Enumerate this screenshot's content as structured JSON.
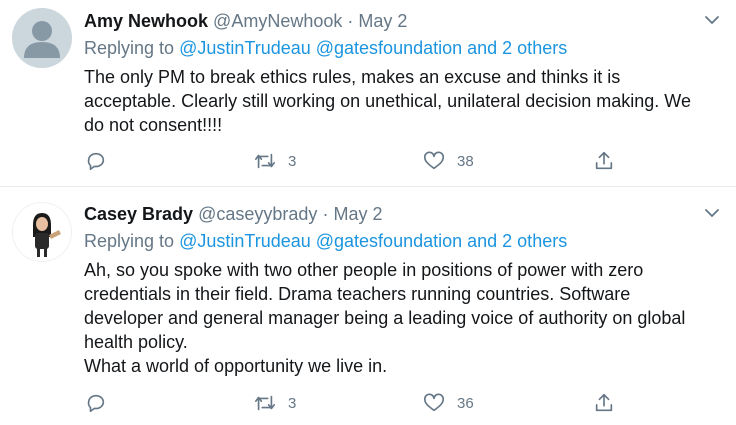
{
  "tweets": [
    {
      "display_name": "Amy Newhook",
      "handle": "@AmyNewhook",
      "separator": "·",
      "date": "May 2",
      "replying_prefix": "Replying to",
      "replying_mentions": "@JustinTrudeau @gatesfoundation and 2 others",
      "text_lines": [
        "The only PM to break ethics rules, makes an excuse and thinks it is",
        "acceptable. Clearly still working on unethical, unilateral decision making. We",
        "do not consent!!!!"
      ],
      "retweets": "3",
      "likes": "38",
      "avatar": "default-profile-icon"
    },
    {
      "display_name": "Casey Brady",
      "handle": "@caseyybrady",
      "separator": "·",
      "date": "May 2",
      "replying_prefix": "Replying to",
      "replying_mentions": "@JustinTrudeau @gatesfoundation and 2 others",
      "text_lines": [
        "Ah, so you spoke with two other people in positions of power with zero",
        "credentials in their field. Drama teachers running countries. Software",
        "developer and general manager being a leading voice of authority on global",
        "health policy.",
        "What a world of opportunity we live in."
      ],
      "retweets": "3",
      "likes": "36",
      "avatar": "bitmoji-avatar"
    }
  ],
  "colors": {
    "text": "#14171a",
    "muted": "#657786",
    "link": "#1b95e0",
    "divider": "#e6ecf0"
  },
  "icons": [
    "chevron-down-icon",
    "reply-icon",
    "retweet-icon",
    "like-icon",
    "share-icon"
  ]
}
